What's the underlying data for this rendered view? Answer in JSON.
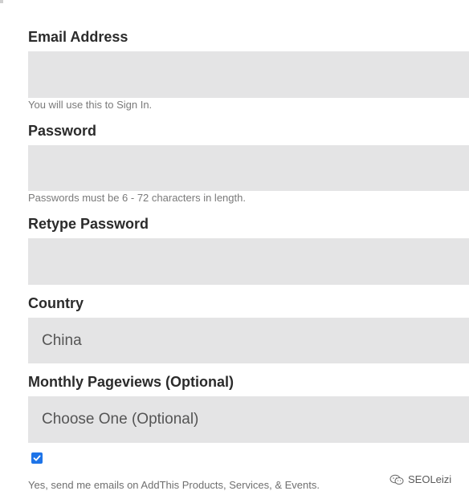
{
  "form": {
    "email": {
      "label": "Email Address",
      "value": "",
      "hint": "You will use this to Sign In."
    },
    "password": {
      "label": "Password",
      "value": "",
      "hint": "Passwords must be 6 - 72 characters in length."
    },
    "retype_password": {
      "label": "Retype Password",
      "value": ""
    },
    "country": {
      "label": "Country",
      "selected": "China"
    },
    "pageviews": {
      "label": "Monthly Pageviews (Optional)",
      "selected": "Choose One (Optional)"
    },
    "newsletter": {
      "checked": true,
      "label": "Yes, send me emails on AddThis Products, Services, & Events."
    }
  },
  "watermark": {
    "icon": "wechat-icon",
    "text": "SEOLeizi"
  },
  "colors": {
    "field_bg": "#e4e4e5",
    "label_text": "#2b2b2b",
    "hint_text": "#7a7a7a",
    "checkbox": "#1e74e8"
  }
}
